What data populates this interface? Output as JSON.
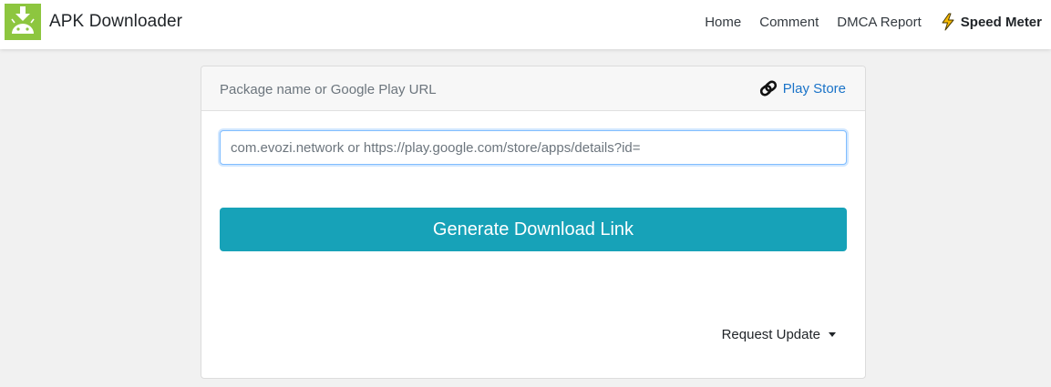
{
  "navbar": {
    "brand": "APK Downloader",
    "links": {
      "home": "Home",
      "comment": "Comment",
      "dmca": "DMCA Report",
      "speed_meter": "Speed Meter"
    },
    "icons": {
      "logo": "android-download-logo-icon",
      "speed": "lightning-bolt-icon"
    },
    "colors": {
      "logo_bg": "#8dc63f",
      "bolt": "#f5b800"
    }
  },
  "card": {
    "header_title": "Package name or Google Play URL",
    "play_store_link": "Play Store",
    "play_store_icon": "link-chain-icon",
    "input": {
      "value": "",
      "placeholder": "com.evozi.network or https://play.google.com/store/apps/details?id="
    },
    "generate_button": "Generate Download Link",
    "request_update": "Request Update",
    "colors": {
      "button": "#17a2b8",
      "link": "#1a73c8"
    }
  }
}
